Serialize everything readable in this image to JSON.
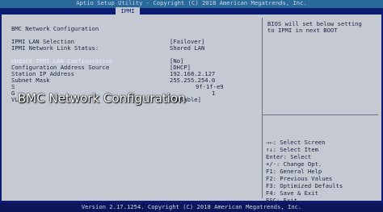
{
  "title_bar": "Aptio Setup Utility - Copyright (C) 2018 American Megatrends, Inc.",
  "tab": "IPMI",
  "section_title": "BMC Network Configuration",
  "rows": [
    {
      "label": "IPMI LAN Selection",
      "value": "[Failover]"
    },
    {
      "label": "IPMI Network Link Status:",
      "value": "Shared LAN"
    },
    {
      "label": "Update IPMI LAN Configuration",
      "value": "[No]"
    },
    {
      "label": "Configuration Address Source",
      "value": "[DHCP]"
    },
    {
      "label": "Station IP Address",
      "value": "192.168.2.127"
    },
    {
      "label": "Subnet Mask",
      "value": "255.255.254.0"
    },
    {
      "label": "S",
      "value": "9f-1f-e9"
    },
    {
      "label": "G",
      "value": "1"
    },
    {
      "label": "VLAN",
      "value": "[Disable]"
    }
  ],
  "overlay_caption": "BMC Network Configuration",
  "help_description": [
    "BIOS will set below setting",
    "to IPMI in next BOOT"
  ],
  "key_help": [
    "→←: Select Screen",
    "↑↓: Select Item",
    "Enter: Select",
    "+/-: Change Opt.",
    "F1: General Help",
    "F2: Previous Values",
    "F3: Optimized Defaults",
    "F4: Save & Exit",
    "ESC: Exit"
  ],
  "footer": "Version 2.17.1254. Copyright (C) 2018 American Megatrends, Inc."
}
